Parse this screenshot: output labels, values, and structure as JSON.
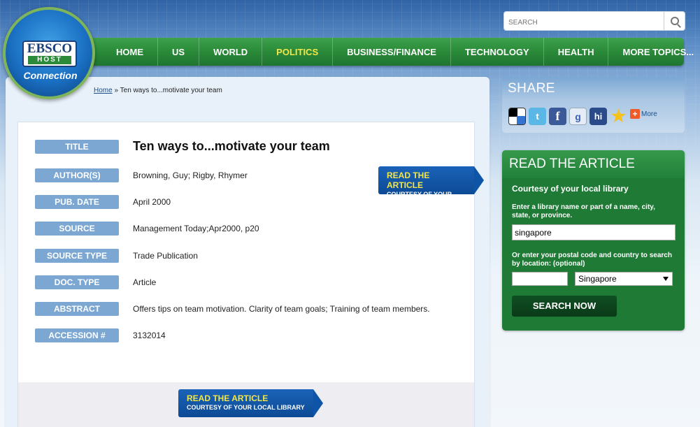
{
  "logo": {
    "top": "EBSCO",
    "mid": "HOST",
    "bottom": "Connection"
  },
  "search": {
    "placeholder": "SEARCH"
  },
  "nav": {
    "items": [
      "HOME",
      "US",
      "WORLD",
      "POLITICS",
      "BUSINESS/FINANCE",
      "TECHNOLOGY",
      "HEALTH",
      "MORE TOPICS..."
    ],
    "active": "POLITICS"
  },
  "breadcrumb": {
    "home": "Home",
    "sep": "»",
    "current": "Ten ways to...motivate your team"
  },
  "article": {
    "fields": [
      {
        "label": "TITLE",
        "value": "Ten ways to...motivate your team"
      },
      {
        "label": "AUTHOR(S)",
        "value": "Browning, Guy; Rigby, Rhymer"
      },
      {
        "label": "PUB. DATE",
        "value": "April 2000"
      },
      {
        "label": "SOURCE",
        "value": "Management Today;Apr2000, p20"
      },
      {
        "label": "SOURCE TYPE",
        "value": "Trade Publication"
      },
      {
        "label": "DOC. TYPE",
        "value": "Article"
      },
      {
        "label": "ABSTRACT",
        "value": "Offers tips on team motivation. Clarity of team goals; Training of team members."
      },
      {
        "label": "ACCESSION #",
        "value": "3132014"
      }
    ]
  },
  "ribbon": {
    "line1": "READ THE ARTICLE",
    "line2": "COURTESY OF YOUR LOCAL LIBRARY"
  },
  "share": {
    "title": "SHARE",
    "more": "More",
    "icons": [
      "delicious-icon",
      "twitter-icon",
      "facebook-icon",
      "google-icon",
      "hi5-icon",
      "favorite-star-icon"
    ]
  },
  "read_panel": {
    "title": "READ THE ARTICLE",
    "subtitle": "Courtesy of your local library",
    "instruction": "Enter a library name or part of a name, city, state, or province.",
    "library_value": "singapore",
    "postal_instruction": "Or enter your postal code and country to search by location: (optional)",
    "postal_value": "",
    "country": "Singapore",
    "button": "SEARCH NOW"
  }
}
